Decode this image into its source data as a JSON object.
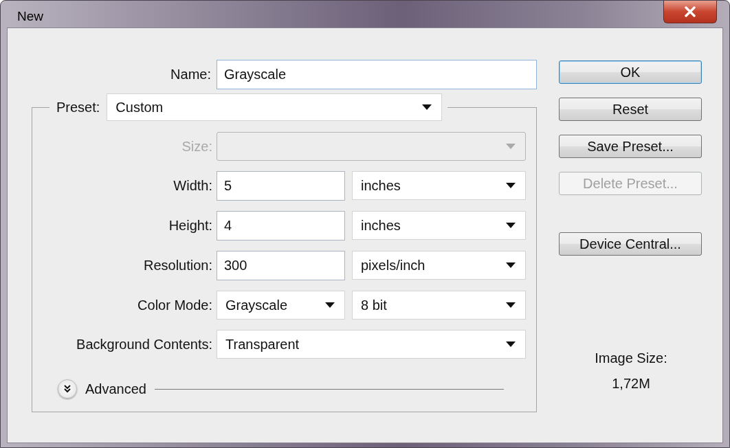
{
  "window": {
    "title": "New"
  },
  "name_field": {
    "label": "Name:",
    "value": "Grayscale"
  },
  "preset": {
    "label": "Preset:",
    "value": "Custom"
  },
  "fields": [
    {
      "kind": "combo",
      "label": "Size:",
      "disabled": true
    },
    {
      "kind": "number_unit",
      "label": "Width:",
      "value": "5",
      "unit": "inches",
      "disabled": false
    },
    {
      "kind": "number_unit",
      "label": "Height:",
      "value": "4",
      "unit": "inches",
      "disabled": false
    },
    {
      "kind": "number_unit",
      "label": "Resolution:",
      "value": "300",
      "unit": "pixels/inch",
      "disabled": false
    },
    {
      "kind": "two_combos",
      "label": "Color Mode:",
      "value": "Grayscale",
      "unit": "8 bit",
      "disabled": false
    },
    {
      "kind": "combo",
      "label": "Background Contents:",
      "value": "Transparent",
      "disabled": false
    }
  ],
  "advanced": {
    "label": "Advanced",
    "expanded": false
  },
  "buttons": [
    {
      "label": "OK",
      "default": true,
      "disabled": false
    },
    {
      "label": "Reset",
      "default": false,
      "disabled": false
    },
    {
      "label": "Save Preset...",
      "default": false,
      "disabled": false
    },
    {
      "label": "Delete Preset...",
      "default": false,
      "disabled": true
    },
    {
      "label": "Device Central...",
      "default": false,
      "disabled": false
    }
  ],
  "image_size": {
    "label": "Image Size:",
    "value": "1,72M"
  }
}
